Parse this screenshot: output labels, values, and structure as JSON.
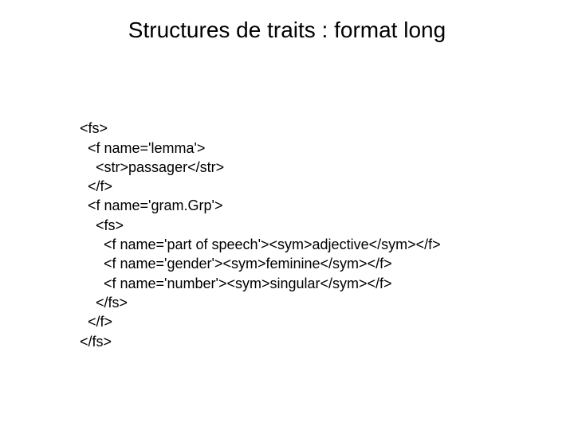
{
  "title": "Structures de traits : format long",
  "lines": {
    "l0": "<fs>",
    "l1": "  <f name='lemma'>",
    "l2": "    <str>passager</str>",
    "l3": "  </f>",
    "l4": "  <f name='gram.Grp'>",
    "l5": "    <fs>",
    "l6": "      <f name='part of speech'><sym>adjective</sym></f>",
    "l7": "      <f name='gender'><sym>feminine</sym></f>",
    "l8": "      <f name='number'><sym>singular</sym></f>",
    "l9": "    </fs>",
    "l10": "  </f>",
    "l11": "</fs>"
  }
}
